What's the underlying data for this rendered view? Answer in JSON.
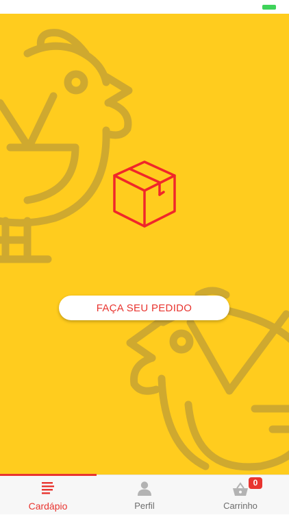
{
  "status_bar": {
    "battery_color": "#3fd35a"
  },
  "hero": {
    "background_color": "#ffcc1e",
    "illustration": "chicken-outline-pattern",
    "central_icon": "package-box-icon"
  },
  "cta": {
    "label": "FAÇA SEU PEDIDO"
  },
  "tabs": [
    {
      "label": "Cardápio",
      "icon": "menu-lines-icon",
      "active": true
    },
    {
      "label": "Perfil",
      "icon": "user-icon",
      "active": false
    },
    {
      "label": "Carrinho",
      "icon": "basket-icon",
      "active": false,
      "badge": "0"
    }
  ],
  "colors": {
    "accent": "#e8342f",
    "inactive": "#b3b3b3"
  }
}
